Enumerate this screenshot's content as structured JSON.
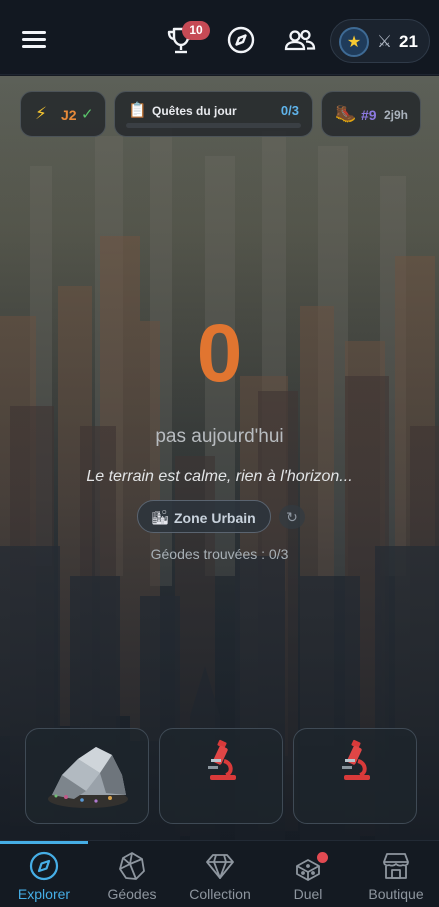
{
  "header": {
    "menu_icon": "hamburger-icon",
    "trophy_badge": "10",
    "player_level": "21"
  },
  "chips": {
    "streak_day": "J2",
    "streak_check": "✓",
    "quests_label": "Quêtes du jour",
    "quests_count": "0/3",
    "quests_progress": 0,
    "rank_number": "#9",
    "rank_time": "2j9h"
  },
  "main": {
    "count": "0",
    "count_sub": "pas aujourd'hui",
    "calm_text": "Le terrain est calme, rien à l'horizon...",
    "zone_label": "Zone Urbain",
    "geodes_found": "Géodes trouvées : 0/3"
  },
  "nav": {
    "items": [
      {
        "label": "Explorer",
        "icon": "compass-icon",
        "active": true
      },
      {
        "label": "Géodes",
        "icon": "geode-icon"
      },
      {
        "label": "Collection",
        "icon": "diamond-icon"
      },
      {
        "label": "Duel",
        "icon": "dice-icon",
        "notification": true
      },
      {
        "label": "Boutique",
        "icon": "shop-icon"
      }
    ]
  },
  "colors": {
    "accent": "#46aee6",
    "count": "#e17530",
    "streak_day": "#e88a3a",
    "rank": "#8c79e0",
    "badge": "#c64a55"
  }
}
